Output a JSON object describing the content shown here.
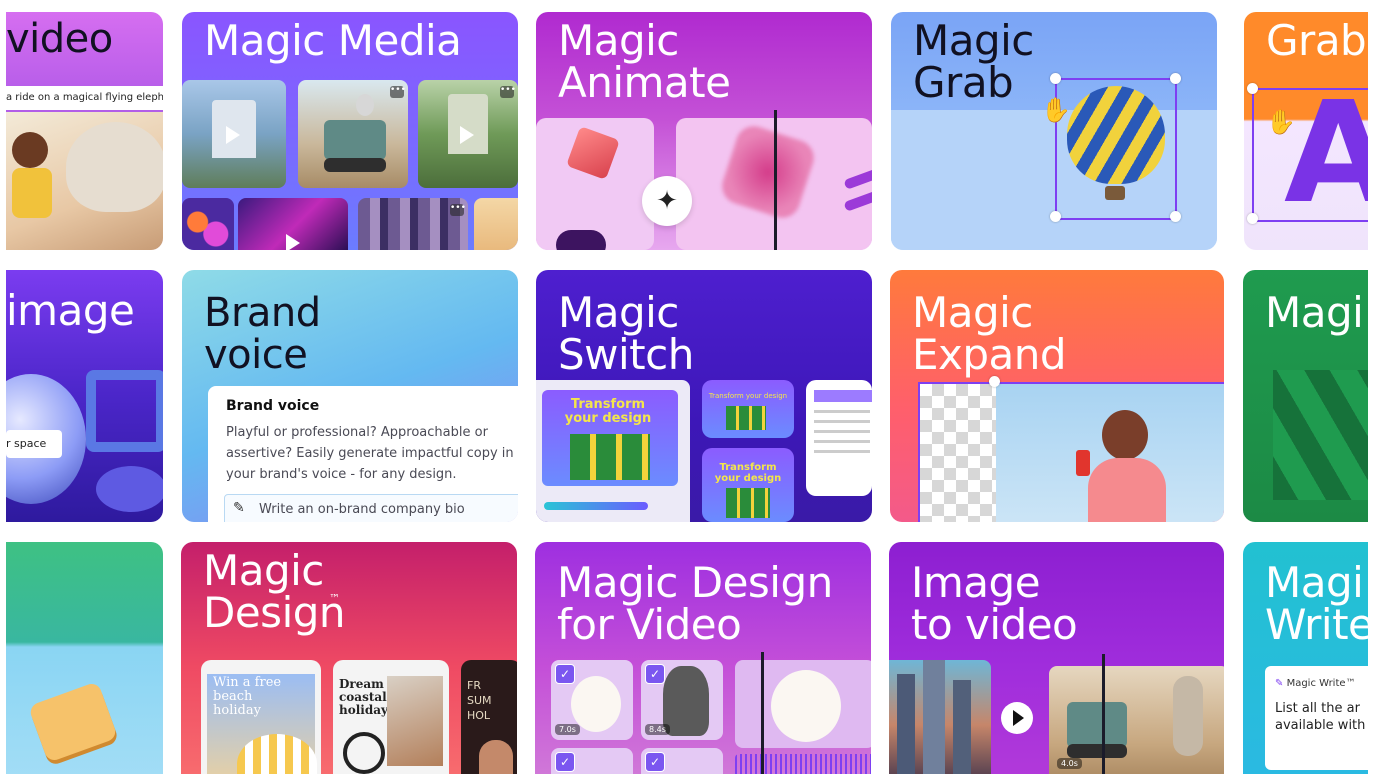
{
  "cards": {
    "video": {
      "title": "video",
      "caption": "a ride on a magical flying eleph"
    },
    "magic_media": {
      "title": "Magic Media"
    },
    "magic_animate": {
      "title": "Magic\nAnimate"
    },
    "magic_grab": {
      "title": "Magic\nGrab"
    },
    "grab": {
      "title": "Grab",
      "letter": "A"
    },
    "image": {
      "title": "image",
      "caption": "r space"
    },
    "brand_voice": {
      "title": "Brand\nvoice",
      "panel_heading": "Brand voice",
      "panel_body": "Playful or professional? Approachable or assertive? Easily generate impactful copy in your brand's voice - for any design.",
      "prompt": "Write an on-brand company bio"
    },
    "magic_switch": {
      "title": "Magic\nSwitch",
      "design_text": "Transform your design"
    },
    "magic_expand": {
      "title": "Magic\nExpand"
    },
    "magic_partial": {
      "title": "Magi"
    },
    "magic_design": {
      "title": "Magic\nDesign",
      "tm": "™",
      "cards": [
        "Win a free beach holiday",
        "Dream coastal holiday",
        "FR SUM HOL"
      ]
    },
    "magic_design_video": {
      "title": "Magic Design\nfor Video",
      "durations": [
        "7.0s",
        "8.4s"
      ]
    },
    "image_to_video": {
      "title": "Image\nto video",
      "duration": "4.0s"
    },
    "magic_write": {
      "title": "Magi\nWrite",
      "label": "Magic Write™",
      "text": "List all the ar available with"
    }
  },
  "colors": {
    "purple": "#7d4dff",
    "magenta": "#c22ad7",
    "blue": "#5f8cf2",
    "orange": "#ff7a3c",
    "green": "#1f9b4f",
    "teal": "#29c3cf"
  },
  "icons": [
    "play-icon",
    "sparkle-icon",
    "grab-hand-icon",
    "pen-icon",
    "checkbox-icon",
    "more-icon"
  ]
}
